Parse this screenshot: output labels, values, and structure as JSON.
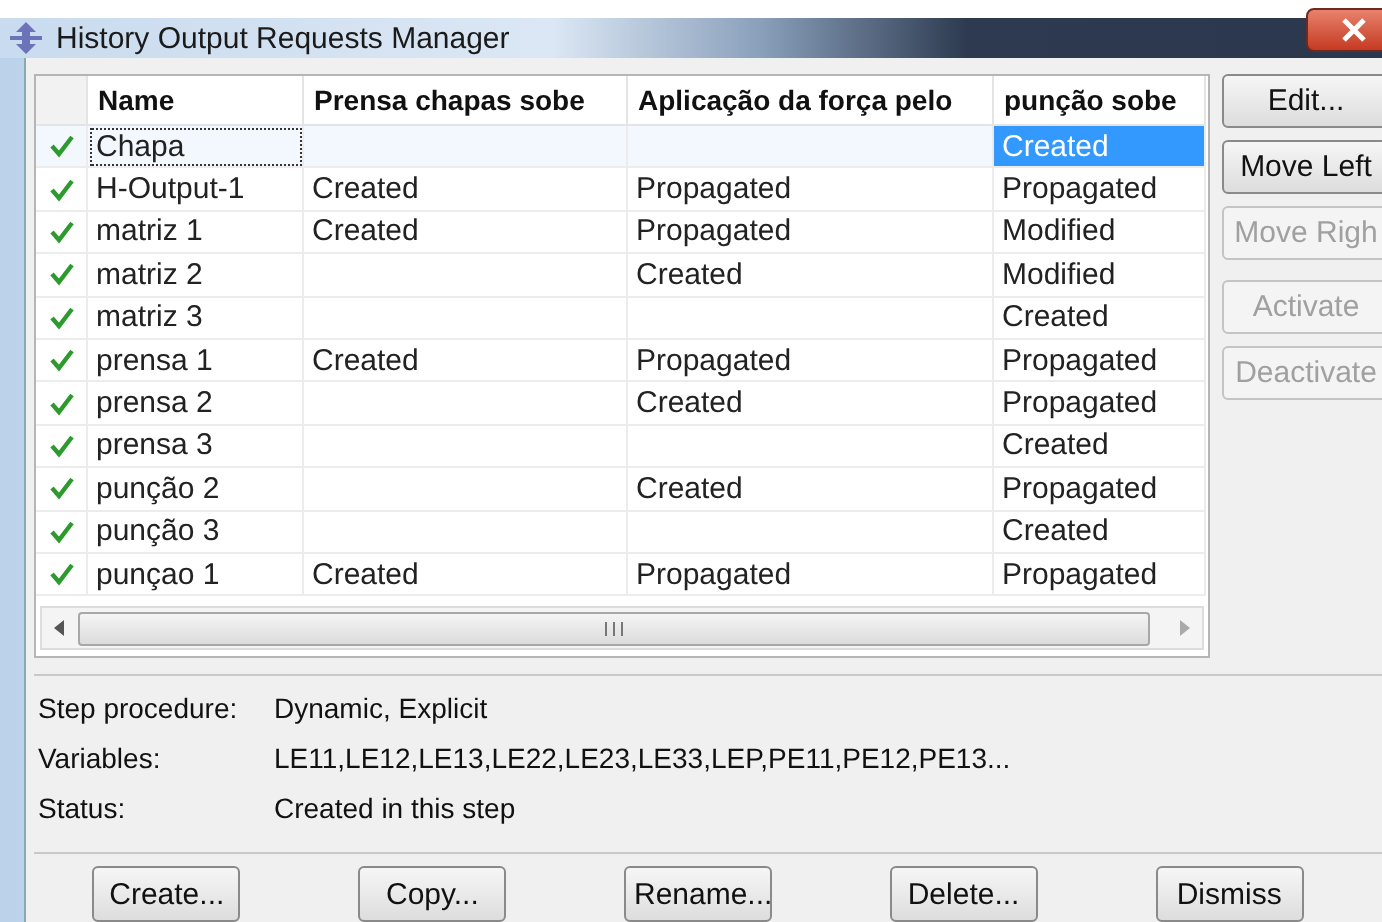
{
  "window": {
    "title": "History Output Requests Manager"
  },
  "table": {
    "columns": [
      "Name",
      "Prensa chapas sobe",
      "Aplicação da força pelo",
      "punção sobe"
    ],
    "rows": [
      {
        "active": true,
        "selected": true,
        "cells": [
          "Chapa",
          "",
          "",
          "Created"
        ]
      },
      {
        "active": true,
        "selected": false,
        "cells": [
          "H-Output-1",
          "Created",
          "Propagated",
          "Propagated"
        ]
      },
      {
        "active": true,
        "selected": false,
        "cells": [
          "matriz 1",
          "Created",
          "Propagated",
          "Modified"
        ]
      },
      {
        "active": true,
        "selected": false,
        "cells": [
          "matriz 2",
          "",
          "Created",
          "Modified"
        ]
      },
      {
        "active": true,
        "selected": false,
        "cells": [
          "matriz 3",
          "",
          "",
          "Created"
        ]
      },
      {
        "active": true,
        "selected": false,
        "cells": [
          "prensa 1",
          "Created",
          "Propagated",
          "Propagated"
        ]
      },
      {
        "active": true,
        "selected": false,
        "cells": [
          "prensa 2",
          "",
          "Created",
          "Propagated"
        ]
      },
      {
        "active": true,
        "selected": false,
        "cells": [
          "prensa 3",
          "",
          "",
          "Created"
        ]
      },
      {
        "active": true,
        "selected": false,
        "cells": [
          "punção 2",
          "",
          "Created",
          "Propagated"
        ]
      },
      {
        "active": true,
        "selected": false,
        "cells": [
          "punção 3",
          "",
          "",
          "Created"
        ]
      },
      {
        "active": true,
        "selected": false,
        "cells": [
          "punçao 1",
          "Created",
          "Propagated",
          "Propagated"
        ]
      }
    ]
  },
  "side_buttons": [
    {
      "label": "Edit...",
      "disabled": false
    },
    {
      "label": "Move Left",
      "disabled": false
    },
    {
      "label": "Move Righ",
      "disabled": true
    },
    {
      "label": "Activate",
      "disabled": true
    },
    {
      "label": "Deactivate",
      "disabled": true
    }
  ],
  "info": [
    {
      "label": "Step procedure:",
      "value": "Dynamic, Explicit"
    },
    {
      "label": "Variables:",
      "value": "LE11,LE12,LE13,LE22,LE23,LE33,LEP,PE11,PE12,PE13..."
    },
    {
      "label": "Status:",
      "value": "Created in this step"
    }
  ],
  "buttons": [
    "Create...",
    "Copy...",
    "Rename...",
    "Delete...",
    "Dismiss"
  ]
}
